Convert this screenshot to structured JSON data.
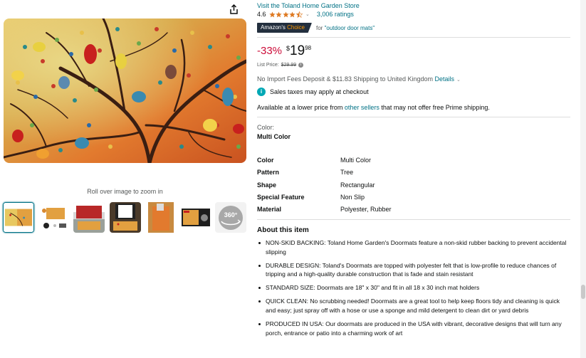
{
  "store": {
    "link_text": "Visit the Toland Home Garden Store"
  },
  "rating": {
    "value": "4.6",
    "stars": 4.5,
    "ratings_count": "3,006 ratings",
    "star_color": "#de7921"
  },
  "badge": {
    "label_a": "Amazon's",
    "label_b": " Choice",
    "for_text": "for ",
    "query": "\"outdoor door mats\""
  },
  "price": {
    "discount": "-33%",
    "symbol": "$",
    "whole": "19",
    "fraction": "98",
    "list_label": "List Price:",
    "list_value": "$29.99",
    "discount_color": "#cc0c39"
  },
  "shipping": {
    "text": "No Import Fees Deposit & $11.83 Shipping to United Kingdom",
    "details_link": "Details"
  },
  "tax": {
    "icon": "info-icon",
    "text": "Sales taxes may apply at checkout"
  },
  "other_sellers": {
    "before": "Available at a lower price from ",
    "link": "other sellers",
    "after": " that may not offer free Prime shipping."
  },
  "color_selection": {
    "label": "Color:",
    "value": "Multi Color"
  },
  "specs": [
    {
      "key": "Color",
      "value": "Multi Color"
    },
    {
      "key": "Pattern",
      "value": "Tree"
    },
    {
      "key": "Shape",
      "value": "Rectangular"
    },
    {
      "key": "Special Feature",
      "value": "Non Slip"
    },
    {
      "key": "Material",
      "value": "Polyester, Rubber"
    }
  ],
  "about": {
    "title": "About this item",
    "bullets": [
      "NON-SKID BACKING: Toland Home Garden's Doormats feature a non-skid rubber backing to prevent accidental slipping",
      "DURABLE DESIGN: Toland's Doormats are topped with polyester felt that is low-profile to reduce chances of tripping and a high-quality durable construction that is fade and stain resistant",
      "STANDARD SIZE: Doormats are 18\" x 30\" and fit in all 18 x 30 inch mat holders",
      "QUICK CLEAN: No scrubbing needed! Doormats are a great tool to help keep floors tidy and cleaning is quick and easy; just spray off with a hose or use a sponge and mild detergent to clean dirt or yard debris",
      "PRODUCED IN USA: Our doormats are produced in the USA with vibrant, decorative designs that will turn any porch, entrance or patio into a charming work of art"
    ]
  },
  "gallery": {
    "zoom_hint": "Roll over image to zoom in",
    "share_icon": "share-icon",
    "thumb_360_label": "360°"
  },
  "colors": {
    "link": "#007185",
    "badge_bg": "#232f3e",
    "badge_accent": "#ff9900"
  }
}
